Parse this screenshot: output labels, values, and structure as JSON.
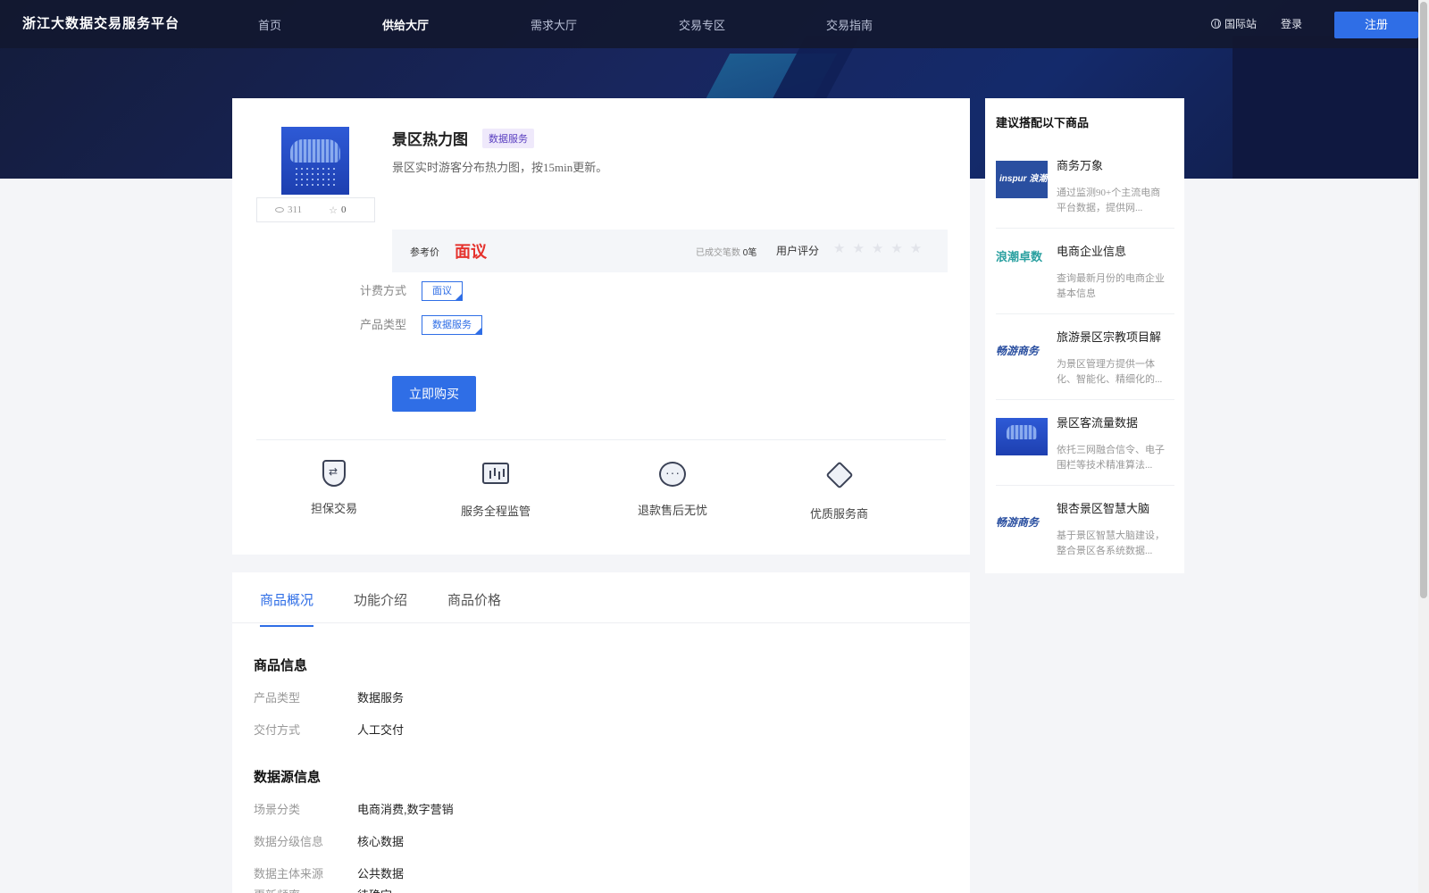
{
  "nav": {
    "brand": "浙江大数据交易服务平台",
    "items": [
      {
        "label": "首页",
        "active": false
      },
      {
        "label": "供给大厅",
        "active": true
      },
      {
        "label": "需求大厅",
        "active": false
      },
      {
        "label": "交易专区",
        "active": false
      },
      {
        "label": "交易指南",
        "active": false
      }
    ],
    "international": "国际站",
    "login": "登录",
    "register": "注册"
  },
  "product": {
    "title": "景区热力图",
    "tag": "数据服务",
    "description": "景区实时游客分布热力图，按15min更新。",
    "views": "311",
    "favorites": "0",
    "price_label": "参考价",
    "price_value": "面议",
    "deals_label": "已成交笔数",
    "deals_value": "0笔",
    "rating_label": "用户评分",
    "rating_stars": "★★★★★",
    "billing_label": "计费方式",
    "billing_value": "面议",
    "type_label": "产品类型",
    "type_value": "数据服务",
    "buy_button": "立即购买"
  },
  "features": [
    {
      "label": "担保交易",
      "icon": "shield-icon"
    },
    {
      "label": "服务全程监管",
      "icon": "monitor-icon"
    },
    {
      "label": "退款售后无忧",
      "icon": "chat-icon"
    },
    {
      "label": "优质服务商",
      "icon": "diamond-icon"
    }
  ],
  "tabs": [
    {
      "label": "商品概况",
      "active": true
    },
    {
      "label": "功能介绍",
      "active": false
    },
    {
      "label": "商品价格",
      "active": false
    }
  ],
  "info": {
    "section1_title": "商品信息",
    "section1": [
      {
        "label": "产品类型",
        "value": "数据服务"
      },
      {
        "label": "交付方式",
        "value": "人工交付"
      }
    ],
    "section2_title": "数据源信息",
    "section2": [
      {
        "label": "场景分类",
        "value": "电商消费,数字营销"
      },
      {
        "label": "数据分级信息",
        "value": "核心数据"
      },
      {
        "label": "数据主体来源",
        "value": "公共数据"
      },
      {
        "label": "更新频率",
        "value": "待确定"
      }
    ]
  },
  "sidebar": {
    "title": "建议搭配以下商品",
    "items": [
      {
        "name": "商务万象",
        "desc": "通过监测90+个主流电商平台数据，提供网...",
        "logo_text": "inspur 浪潮",
        "logo_icon": "inspur-logo-icon"
      },
      {
        "name": "电商企业信息",
        "desc": "查询最新月份的电商企业基本信息",
        "logo_text": "浪潮卓数",
        "logo_icon": "inspur-droso-logo-icon"
      },
      {
        "name": "旅游景区宗教项目解",
        "desc": "为景区管理方提供一体化、智能化、精细化的...",
        "logo_text": "畅游商务",
        "logo_icon": "chinaums-logo-icon"
      },
      {
        "name": "景区客流量数据",
        "desc": "依托三网融合信令、电子围栏等技术精准算法...",
        "logo_text": "",
        "logo_icon": "cloud-rain-logo-icon"
      },
      {
        "name": "银杏景区智慧大脑",
        "desc": "基于景区智慧大脑建设，整合景区各系统数据...",
        "logo_text": "畅游商务",
        "logo_icon": "chinaums-logo-icon"
      }
    ]
  },
  "colors": {
    "accent": "#2f6ee6",
    "price_red": "#e5322d",
    "nav_bg": "#121830"
  }
}
